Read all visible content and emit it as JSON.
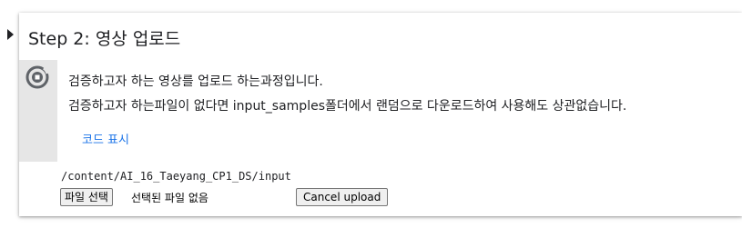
{
  "cell": {
    "title": "Step 2: 영상 업로드",
    "collapse_icon": "triangle-right-icon",
    "run_icon": "run-cell-icon"
  },
  "markdown": {
    "line1": "검증하고자 하는 영상를 업로드 하는과정입니다.",
    "line2": "검증하고자 하는파일이 없다면 input_samples폴더에서 랜덤으로 다운로드하여 사용해도 상관없습니다.",
    "show_code_label": "코드 표시"
  },
  "output": {
    "path": "/content/AI_16_Taeyang_CP1_DS/input",
    "file_button_label": "파일 선택",
    "file_status": "선택된 파일 없음",
    "cancel_label": "Cancel upload"
  },
  "colors": {
    "link": "#1a73e8",
    "gutter": "#e6e6e6",
    "text": "#202124"
  }
}
